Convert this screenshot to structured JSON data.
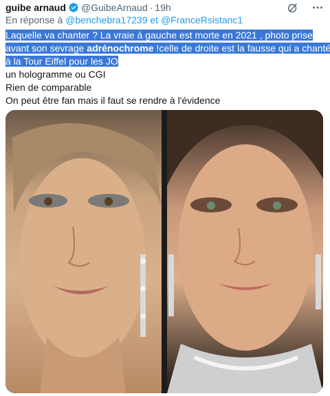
{
  "tweet": {
    "author_name": "guibe arnaud",
    "handle": "@GuibeArnaud",
    "separator": "·",
    "time": "19h",
    "reply_prefix": "En réponse à",
    "reply_mention_1": "@benchebra17239",
    "reply_conjunction": "et",
    "reply_mention_2": "@FranceRsistanc1",
    "lines": {
      "l1": "Laquelle va chanter ? La vraie à gauche est morte en 2021 , photo prise",
      "l2a": "avant son sevrage ",
      "l2b": "adrénochrome",
      "l2c": " !celle de droite est la fausse qui a chanté",
      "l3": "à la Tour Eiffel pour les JO",
      "l4": "un hologramme ou CGI",
      "l5": "Rien de comparable",
      "l6": "On peut être fan mais il faut se rendre à l'évidence"
    }
  },
  "icons": {
    "verified": "verified-badge-icon",
    "grok": "grok-icon",
    "more": "more-options-icon"
  },
  "colors": {
    "accent": "#1d9bf0",
    "highlight": "#3a78d8",
    "muted": "#536471"
  }
}
